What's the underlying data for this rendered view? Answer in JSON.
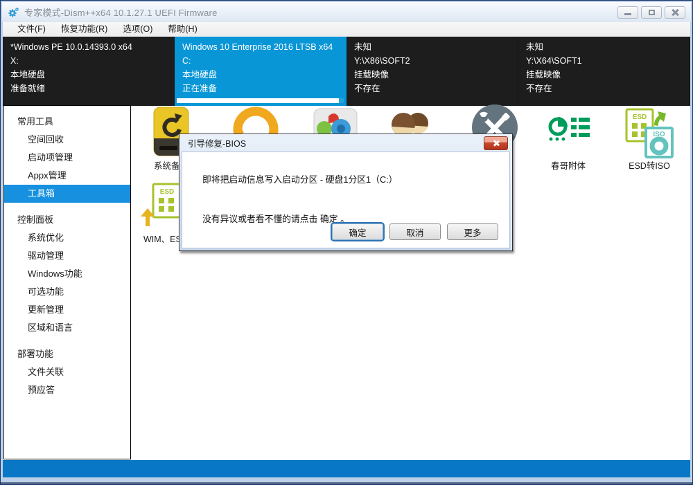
{
  "window": {
    "title": "专家模式-Dism++x64 10.1.27.1 UEFI Firmware"
  },
  "menu": {
    "items": [
      {
        "label": "文件(F)"
      },
      {
        "label": "恢复功能(R)"
      },
      {
        "label": "选项(O)"
      },
      {
        "label": "帮助(H)"
      }
    ]
  },
  "header": {
    "columns": [
      {
        "name": "*Windows PE 10.0.14393.0 x64",
        "path": "X:",
        "type": "本地硬盘",
        "status": "准备就绪"
      },
      {
        "name": "Windows 10 Enterprise 2016 LTSB x64",
        "path": "C:",
        "type": "本地硬盘",
        "status": "正在准备"
      },
      {
        "name": "未知",
        "path": "Y:\\X86\\SOFT2",
        "type": "挂载映像",
        "status": "不存在"
      },
      {
        "name": "未知",
        "path": "Y:\\X64\\SOFT1",
        "type": "挂载映像",
        "status": "不存在"
      }
    ],
    "active_progress_percent": 97
  },
  "sidebar": {
    "groups": [
      {
        "label": "常用工具",
        "items": [
          "空间回收",
          "启动项管理",
          "Appx管理",
          "工具箱"
        ]
      },
      {
        "label": "控制面板",
        "items": [
          "系统优化",
          "驱动管理",
          "Windows功能",
          "可选功能",
          "更新管理",
          "区域和语言"
        ]
      },
      {
        "label": "部署功能",
        "items": [
          "文件关联",
          "预应答"
        ]
      }
    ],
    "selected": "工具箱"
  },
  "tools": {
    "labels": {
      "backup": "系统备份",
      "chunge": "春哥附体",
      "esd_to_iso": "ESD转ISO",
      "wim_esd": "WIM、ESD"
    },
    "icon_texts": {
      "esd": "ESD",
      "iso": "ISO"
    }
  },
  "dialog": {
    "title": "引导修复-BIOS",
    "message_line1": "即将把启动信息写入启动分区 - 硬盘1分区1（C:）",
    "message_line2": "没有异议或者看不懂的请点击 确定 。",
    "buttons": {
      "ok": "确定",
      "cancel": "取消",
      "more": "更多"
    }
  },
  "colors": {
    "header_active": "#0996D7",
    "sidebar_selected": "#1690DF",
    "bottom_progress": "#0877C6",
    "dialog_close_red": "#C74A31",
    "tool_green": "#009C5B",
    "esd_green": "#A6C32E",
    "iso_teal": "#63C3BE"
  }
}
